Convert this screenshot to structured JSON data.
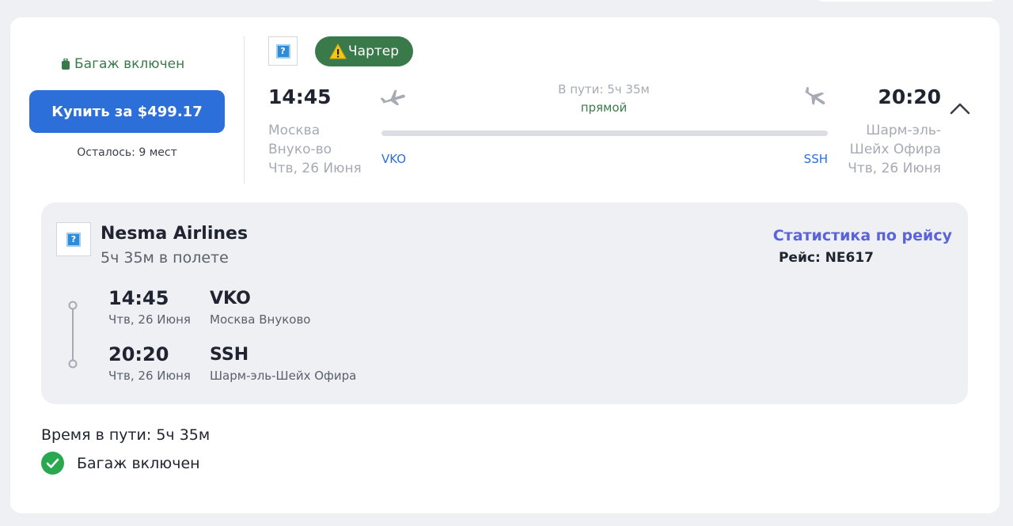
{
  "summary": {
    "baggage_label": "Багаж включен",
    "buy_button_label": "Купить за $499.17",
    "seats_left": "Осталось: 9 мест",
    "charter_badge": "Чартер",
    "departure": {
      "time": "14:45",
      "city": "Москва Внуко-во",
      "date": "Чтв, 26 Июня",
      "code": "VKO"
    },
    "arrival": {
      "time": "20:20",
      "city": "Шарм-эль-Шейх Офира",
      "date": "Чтв, 26 Июня",
      "code": "SSH"
    },
    "duration": "В пути: 5ч 35м",
    "stops": "прямой"
  },
  "details": {
    "airline_name": "Nesma Airlines",
    "flight_duration": "5ч 35м в полете",
    "stats_link": "Статистика по рейсу",
    "flight_number": "Рейс: NE617",
    "segments": [
      {
        "time": "14:45",
        "date": "Чтв, 26 Июня",
        "code": "VKO",
        "airport": "Москва Внуково"
      },
      {
        "time": "20:20",
        "date": "Чтв, 26 Июня",
        "code": "SSH",
        "airport": "Шарм-эль-Шейх Офира"
      }
    ]
  },
  "footer": {
    "total_duration": "Время в пути: 5ч 35м",
    "baggage_label": "Багаж включен"
  },
  "icons": {
    "logo_placeholder": "?",
    "baggage": "suitcase-icon",
    "warning": "warning-icon",
    "departure": "plane-takeoff-icon",
    "arrival": "plane-landing-icon",
    "collapse": "chevron-up-icon",
    "check": "check-circle-icon"
  },
  "colors": {
    "primary_blue": "#2d6fd9",
    "charter_green": "#3a7a4a",
    "stats_link_purple": "#5a63d8",
    "check_green": "#2aa84f",
    "muted_text": "#a6aab3"
  }
}
